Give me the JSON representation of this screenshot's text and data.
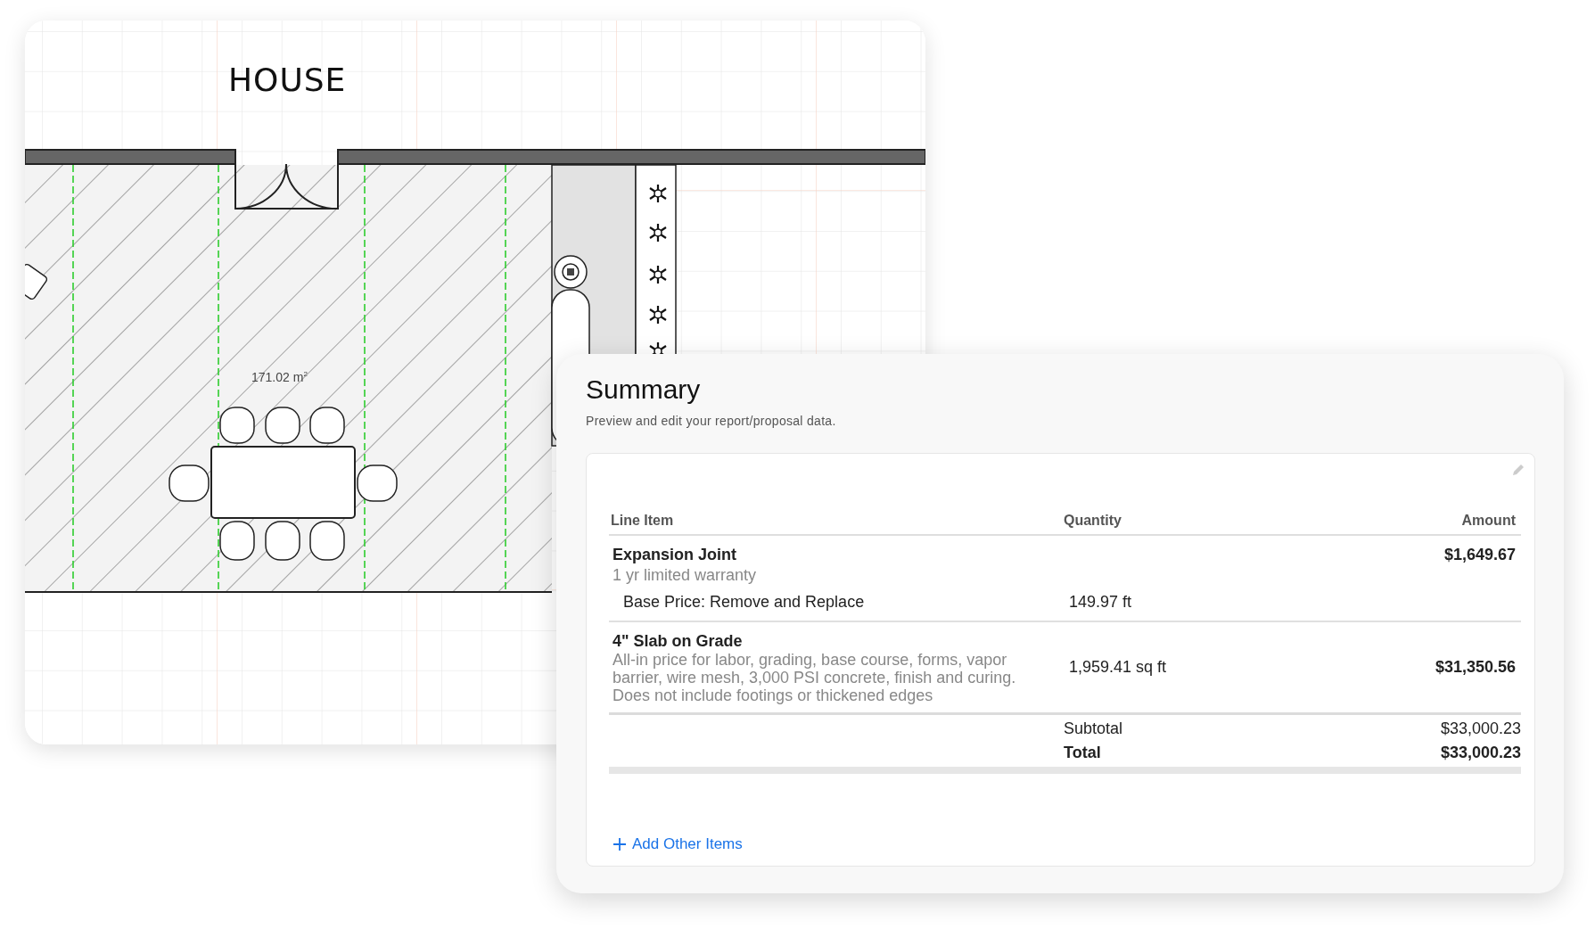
{
  "floor_plan": {
    "title": "HOUSE",
    "area_label": "171.02 m$^{2}$"
  },
  "summary": {
    "title": "Summary",
    "subtitle": "Preview and edit your report/proposal data.",
    "columns": [
      "Line Item",
      "Quantity",
      "Amount"
    ],
    "rows": [
      {
        "title": "Expansion Joint",
        "description": "1 yr limited warranty",
        "amount": "$1,649.67",
        "sub_items": [
          {
            "label": "Base Price: Remove and Replace",
            "quantity": "149.97 ft"
          }
        ]
      },
      {
        "title": "4\" Slab on Grade",
        "description": "All-in price for labor, grading, base course, forms, vapor barrier, wire mesh, 3,000 PSI concrete, finish and curing. Does not include footings or thickened edges",
        "quantity": "1,959.41 sq ft",
        "amount": "$31,350.56"
      }
    ],
    "totals": [
      {
        "kind": "subtotal",
        "label": "Subtotal",
        "value": "$33,000.23"
      },
      {
        "kind": "total",
        "label": "Total",
        "value": "$33,000.23"
      }
    ],
    "add_button": "Add Other Items"
  }
}
